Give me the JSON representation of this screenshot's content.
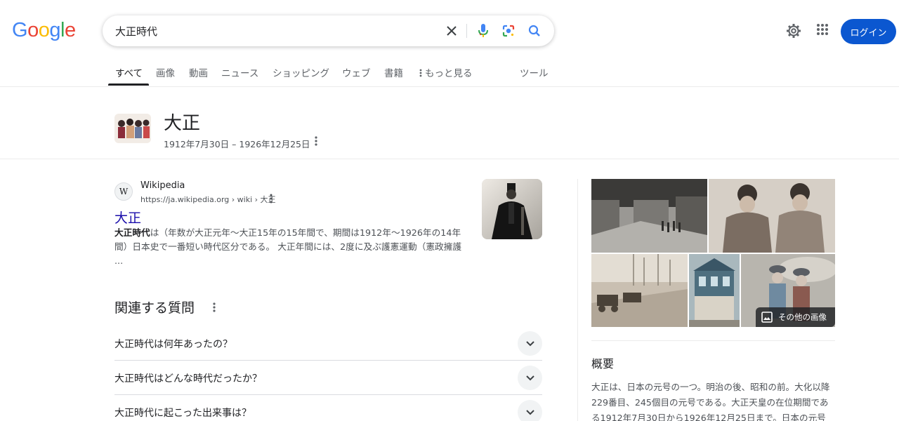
{
  "header": {
    "logo_letters": [
      "G",
      "o",
      "o",
      "g",
      "l",
      "e"
    ],
    "logo_colors": [
      "#4285F4",
      "#EA4335",
      "#FBBC05",
      "#4285F4",
      "#34A853",
      "#EA4335"
    ],
    "search_value": "大正時代",
    "login_label": "ログイン",
    "accent_color": "#0b57d0"
  },
  "tabs": {
    "items": [
      "すべて",
      "画像",
      "動画",
      "ニュース",
      "ショッピング",
      "ウェブ",
      "書籍",
      "もっと見る"
    ],
    "tools": "ツール",
    "active": "すべて"
  },
  "entity": {
    "title": "大正",
    "subtitle": "1912年7月30日 – 1926年12月25日"
  },
  "result": {
    "site_name": "Wikipedia",
    "favicon_letter": "W",
    "url": "https://ja.wikipedia.org › wiki › 大正",
    "title": "大正",
    "snippet_bold": "大正時代",
    "snippet_rest": "は（年数が大正元年～大正15年の15年間で、期間は1912年～1926年の14年間）日本史で一番短い時代区分である。 大正年間には、2度に及ぶ護憲運動（憲政擁護 ..."
  },
  "related_questions": {
    "title": "関連する質問",
    "items": [
      "大正時代は何年あったの？",
      "大正時代はどんな時代だったか？",
      "大正時代に起こった出来事は？"
    ]
  },
  "side_panel": {
    "more_images_label": "その他の画像",
    "overview_title": "概要",
    "overview_text": "大正は、日本の元号の一つ。明治の後、昭和の前。大化以降229番目、245個目の元号である。大正天皇の在位期間である1912年7月30日から1926年12月25日まで。日本の元号"
  }
}
